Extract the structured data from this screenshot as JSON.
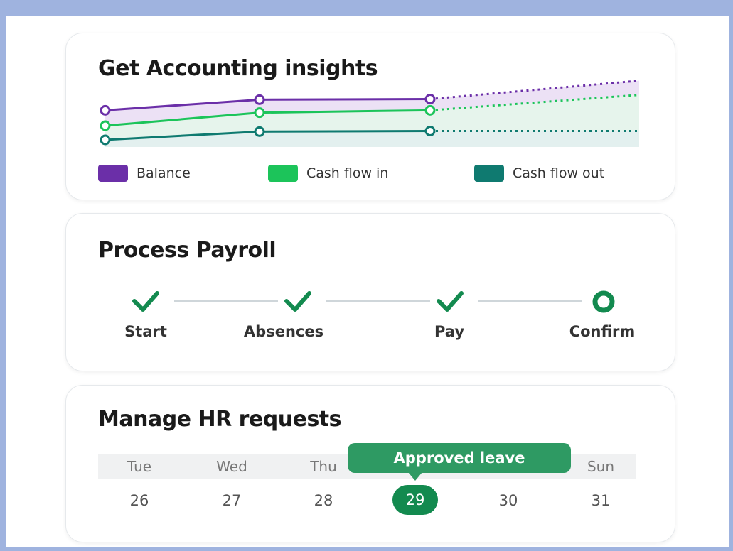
{
  "colors": {
    "balance": "#6b2fa8",
    "cash_flow_in": "#1cc45a",
    "cash_flow_out": "#0f7a70",
    "accent_green": "#138a4f",
    "step_line": "#cfd6da"
  },
  "accounting": {
    "title": "Get Accounting insights",
    "legend": [
      {
        "label": "Balance",
        "color": "#6b2fa8"
      },
      {
        "label": "Cash flow in",
        "color": "#1cc45a"
      },
      {
        "label": "Cash flow out",
        "color": "#0f7a70"
      }
    ]
  },
  "chart_data": {
    "type": "line",
    "x": [
      0,
      1,
      2,
      3
    ],
    "series": [
      {
        "name": "Balance",
        "color": "#6b2fa8",
        "fill": "#ece1f5",
        "values": [
          3.1,
          4.0,
          4.05,
          5.6
        ],
        "projected_from": 2
      },
      {
        "name": "Cash flow in",
        "color": "#1cc45a",
        "fill": "#e6f4ec",
        "values": [
          1.8,
          2.9,
          3.1,
          4.4
        ],
        "projected_from": 2
      },
      {
        "name": "Cash flow out",
        "color": "#0f7a70",
        "fill": "#e3f0ef",
        "values": [
          0.6,
          1.3,
          1.35,
          1.35
        ],
        "projected_from": 2
      }
    ],
    "ylim": [
      0,
      6
    ],
    "grid": false,
    "legend_position": "bottom"
  },
  "payroll": {
    "title": "Process Payroll",
    "steps": [
      {
        "label": "Start",
        "done": true
      },
      {
        "label": "Absences",
        "done": true
      },
      {
        "label": "Pay",
        "done": true
      },
      {
        "label": "Confirm",
        "done": false
      }
    ]
  },
  "hr": {
    "title": "Manage HR requests",
    "days": [
      {
        "name": "Tue",
        "date": "26"
      },
      {
        "name": "Wed",
        "date": "27"
      },
      {
        "name": "Thu",
        "date": "28"
      },
      {
        "name": "",
        "date": "29"
      },
      {
        "name": "",
        "date": "30"
      },
      {
        "name": "Sun",
        "date": "31"
      }
    ],
    "selected_index": 3,
    "tooltip": "Approved leave"
  }
}
